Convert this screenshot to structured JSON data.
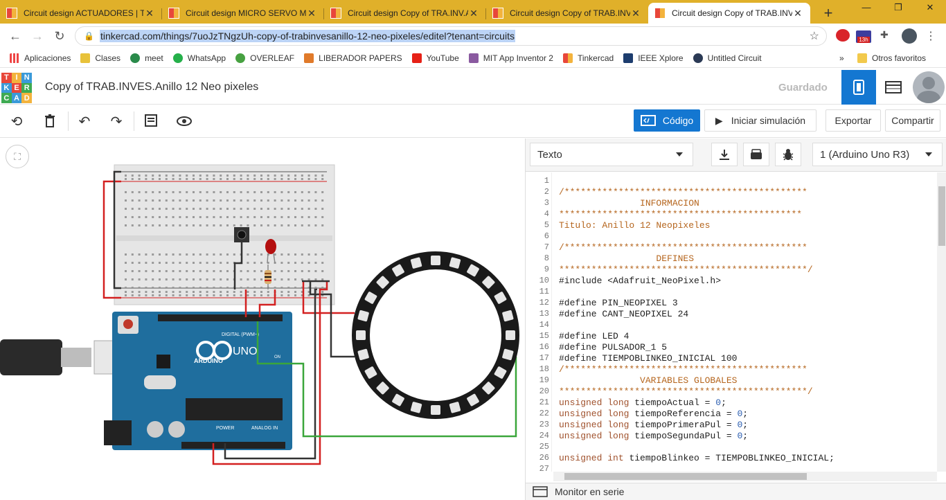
{
  "browser": {
    "tabs": [
      {
        "title": "Circuit design ACTUADORES | Ti",
        "active": false
      },
      {
        "title": "Circuit design MICRO SERVO Mi",
        "active": false
      },
      {
        "title": "Circuit design Copy of TRA.INV.A",
        "active": false
      },
      {
        "title": "Circuit design Copy of TRAB.INV",
        "active": false
      },
      {
        "title": "Circuit design Copy of TRAB.INV",
        "active": true
      }
    ],
    "url": "tinkercad.com/things/7uoJzTNgzUh-copy-of-trabinvesanillo-12-neo-pixeles/editel?tenant=circuits",
    "badge": "13h",
    "bookmarks": [
      "Aplicaciones",
      "Clases",
      "meet",
      "WhatsApp",
      "OVERLEAF",
      "LIBERADOR PAPERS",
      "YouTube",
      "MIT App Inventor 2",
      "Tinkercad",
      "IEEE Xplore",
      "Untitled Circuit"
    ],
    "other_bookmarks": "Otros favoritos"
  },
  "app": {
    "logo": [
      "TIN",
      "KER",
      "CAD"
    ],
    "title": "Copy of TRAB.INVES.Anillo 12 Neo pixeles",
    "saved": "Guardado"
  },
  "toolbar": {
    "code_label": "Código",
    "sim_label": "Iniciar simulación",
    "export_label": "Exportar",
    "share_label": "Compartir"
  },
  "code_panel": {
    "mode": "Texto",
    "device": "1 (Arduino Uno R3)",
    "serial_label": "Monitor en serie",
    "lines": [
      "",
      "/*********************************************",
      "               INFORMACION",
      "*********************************************",
      "Titulo: Anillo 12 Neopixeles",
      "",
      "/*********************************************",
      "                  DEFINES",
      "**********************************************/",
      "#include <Adafruit_NeoPixel.h>",
      "",
      "#define PIN_NEOPIXEL 3",
      "#define CANT_NEOPIXEL 24",
      "",
      "#define LED 4",
      "#define PULSADOR_1 5",
      "#define TIEMPOBLINKEO_INICIAL 100",
      "/*********************************************",
      "               VARIABLES GLOBALES",
      "**********************************************/",
      "unsigned long tiempoActual = 0;",
      "unsigned long tiempoReferencia = 0;",
      "unsigned long tiempoPrimeraPul = 0;",
      "unsigned long tiempoSegundaPul = 0;",
      "",
      "unsigned int tiempoBlinkeo = TIEMPOBLINKEO_INICIAL;",
      "",
      ""
    ]
  },
  "circuit": {
    "arduino_brand": "ARDUINO",
    "arduino_model": "UNO",
    "digital_label": "DIGITAL (PWM~)",
    "power_label": "POWER",
    "analog_label": "ANALOG IN",
    "on_label": "ON",
    "neopixel_count": 24
  },
  "colors": {
    "accent": "#1477d1",
    "tab_bar": "#e0b02a",
    "arduino": "#1f6e9e",
    "wire_red": "#d32020",
    "wire_green": "#3aa63a",
    "wire_black": "#333333"
  }
}
